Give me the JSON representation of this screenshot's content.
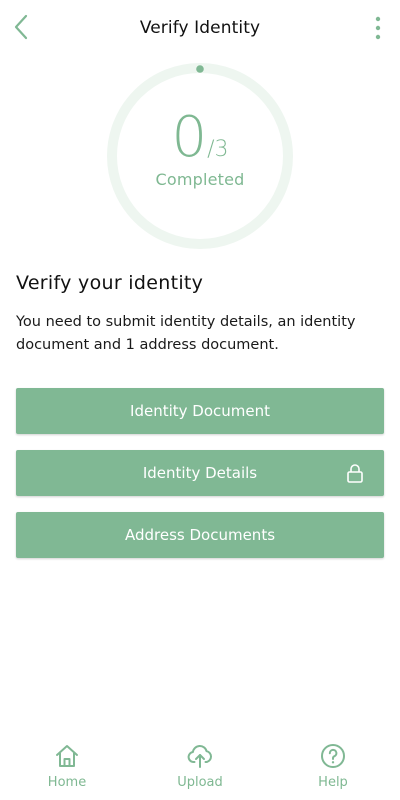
{
  "header": {
    "title": "Verify Identity",
    "back_icon": "chevron-left-icon",
    "more_icon": "more-vertical-icon"
  },
  "progress": {
    "completed": "0",
    "total": "/3",
    "caption": "Completed",
    "fraction": 0
  },
  "content": {
    "title": "Verify your identity",
    "description": "You need to submit identity details, an identity document and 1 address document."
  },
  "actions": [
    {
      "label": "Identity Document",
      "locked": false
    },
    {
      "label": "Identity Details",
      "locked": true,
      "icon": "lock-icon"
    },
    {
      "label": "Address Documents",
      "locked": false
    }
  ],
  "bottom_nav": [
    {
      "label": "Home",
      "icon": "home-icon"
    },
    {
      "label": "Upload",
      "icon": "cloud-upload-icon"
    },
    {
      "label": "Help",
      "icon": "help-circle-icon"
    }
  ],
  "colors": {
    "accent": "#80b894",
    "ring_track": "#eef6f0",
    "text": "#111111",
    "background": "#ffffff"
  }
}
